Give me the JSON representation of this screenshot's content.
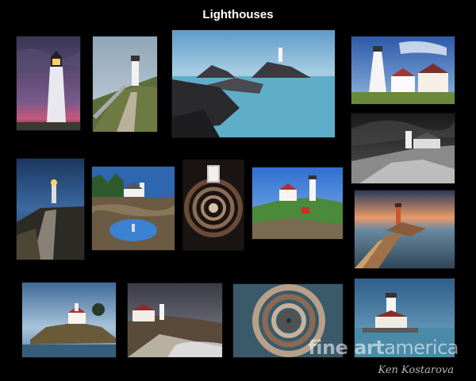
{
  "title": "Lighthouses",
  "watermark": {
    "brand": "fine art",
    "brand2": "america"
  },
  "signature": "Ken Kostarova",
  "photos": [
    {
      "subject": "white lighthouse at purple dusk"
    },
    {
      "subject": "lighthouse with stone steps"
    },
    {
      "subject": "long exposure sea with rocky islet lighthouse"
    },
    {
      "subject": "lighthouse with keeper house under blue sky"
    },
    {
      "subject": "black and white lighthouse on rocks"
    },
    {
      "subject": "lighthouse on causeway at night"
    },
    {
      "subject": "lighthouse reflected in tide pool"
    },
    {
      "subject": "spiral staircase looking up"
    },
    {
      "subject": "lighthouse with red shed on green hill"
    },
    {
      "subject": "red lighthouse with walkway at sunset"
    },
    {
      "subject": "lighthouse on rocky island"
    },
    {
      "subject": "lighthouse with keeper house on shore"
    },
    {
      "subject": "spiral staircase looking down"
    },
    {
      "subject": "lighthouse on pier in blue water"
    }
  ]
}
